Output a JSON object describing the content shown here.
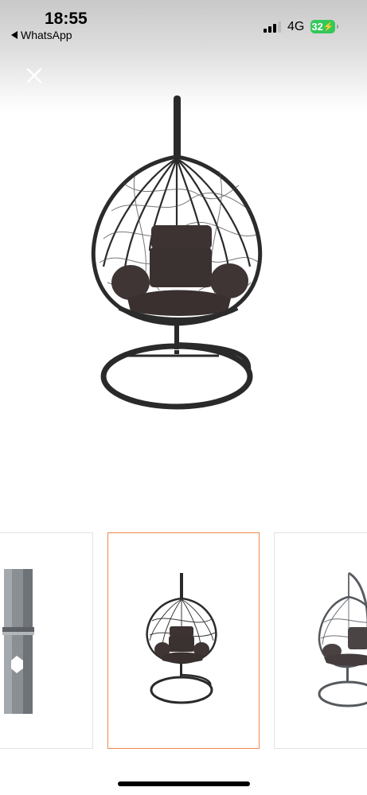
{
  "status_bar": {
    "time": "18:55",
    "back_app": "WhatsApp",
    "network": "4G",
    "battery": "32"
  },
  "viewer": {
    "close_icon": "close-icon",
    "main_image": "hanging-egg-chair",
    "thumbnails": [
      {
        "subject": "pole-detail",
        "selected": false
      },
      {
        "subject": "hanging-egg-chair",
        "selected": true
      },
      {
        "subject": "hanging-egg-chair-side",
        "selected": false
      }
    ],
    "selected_border_color": "#f08a4b"
  }
}
